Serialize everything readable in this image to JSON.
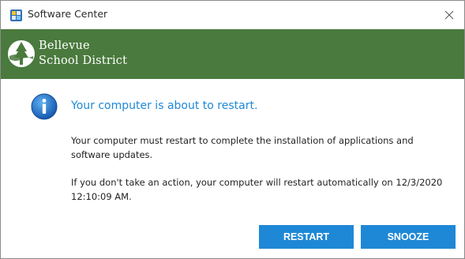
{
  "window": {
    "title": "Software Center"
  },
  "brand": {
    "line1": "Bellevue",
    "line2": "School District",
    "color": "#4a7a3d"
  },
  "dialog": {
    "headline": "Your computer is about to restart.",
    "message": "Your computer must restart to complete the installation of applications and software updates.",
    "auto_restart_notice": "If you don't take an action, your computer will restart automatically on 12/3/2020 12:10:09 AM.",
    "accent_color": "#1f88d6"
  },
  "buttons": {
    "restart_label": "RESTART",
    "snooze_label": "SNOOZE"
  },
  "icons": {
    "app": "software-center-icon",
    "close": "close-icon",
    "logo": "bellevue-logo-icon",
    "info": "info-icon"
  }
}
